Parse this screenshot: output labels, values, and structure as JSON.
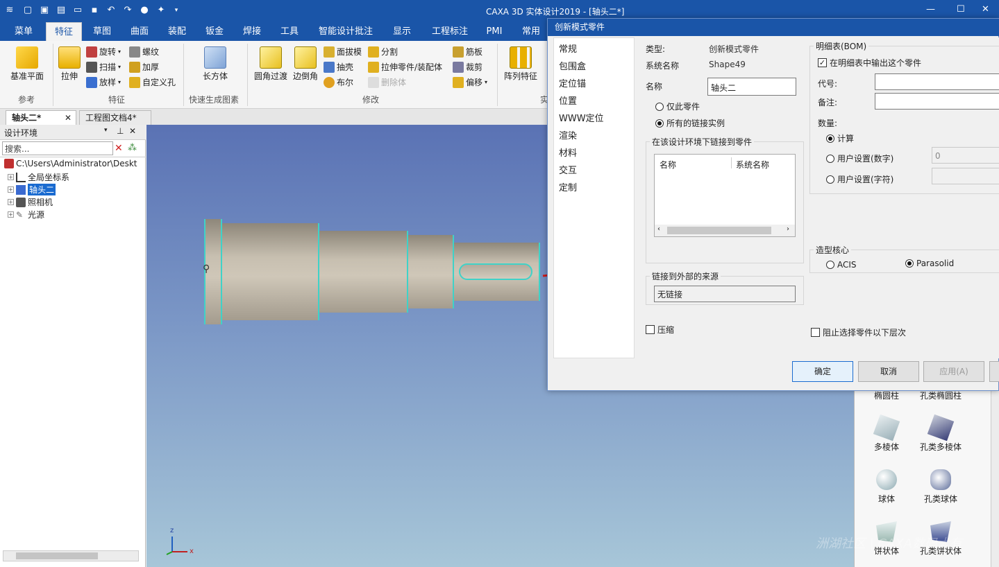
{
  "app": {
    "title": "CAXA 3D 实体设计2019 - [轴头二*]"
  },
  "menu_tabs": [
    "菜单",
    "特征",
    "草图",
    "曲面",
    "装配",
    "钣金",
    "焊接",
    "工具",
    "智能设计批注",
    "显示",
    "工程标注",
    "PMI",
    "常用"
  ],
  "ribbon": {
    "datum_plane": "基准平面",
    "group_reference": "参考",
    "extrude": "拉伸",
    "revolve": "旋转",
    "sweep": "扫描",
    "loft": "放样",
    "thread": "螺纹",
    "thicken": "加厚",
    "custom_hole": "自定义孔",
    "group_feature": "特征",
    "box": "长方体",
    "group_quick": "快速生成图素",
    "fillet": "圆角过渡",
    "chamfer": "边倒角",
    "draft": "面拔模",
    "shell": "抽壳",
    "boolean": "布尔",
    "split": "分割",
    "extrude_part": "拉伸零件/装配体",
    "delete_body": "删除体",
    "rib": "筋板",
    "trim": "裁剪",
    "offset": "偏移",
    "group_modify": "修改",
    "pattern": "阵列特征",
    "group_solid": "实"
  },
  "doc_tabs": [
    "轴头二*",
    "工程图文档4*"
  ],
  "left_panel": {
    "title": "设计环境",
    "search_placeholder": "搜索...",
    "root": "C:\\Users\\Administrator\\Deskt",
    "items": [
      "全局坐标系",
      "轴头二",
      "照相机",
      "光源"
    ]
  },
  "shape_library": {
    "items": [
      "椭圆柱",
      "孔类椭圆柱",
      "多棱体",
      "孔类多棱体",
      "球体",
      "孔类球体",
      "饼状体",
      "孔类饼状体"
    ]
  },
  "dialog": {
    "title": "创新模式零件",
    "nav": [
      "常规",
      "包围盒",
      "定位锚",
      "位置",
      "WWW定位",
      "渲染",
      "材料",
      "交互",
      "定制"
    ],
    "type_label": "类型:",
    "type_value": "创新模式零件",
    "sysname_label": "系统名称",
    "sysname_value": "Shape49",
    "name_label": "名称",
    "name_value": "轴头二",
    "radio_only_part": "仅此零件",
    "radio_all_links": "所有的链接实例",
    "linked_group": "在该设计环境下链接到零件",
    "col_name": "名称",
    "col_sysname": "系统名称",
    "external_group": "链接到外部的来源",
    "external_value": "无链接",
    "compress": "压缩",
    "bom_group": "明细表(BOM)",
    "bom_output": "在明细表中输出这个零件",
    "code_label": "代号:",
    "remark_label": "备注:",
    "qty_label": "数量:",
    "qty_calc": "计算",
    "qty_user_num": "用户设置(数字)",
    "qty_user_num_value": "0",
    "qty_user_str": "用户设置(字符)",
    "kernel_group": "造型核心",
    "kernel_acis": "ACIS",
    "kernel_parasolid": "Parasolid",
    "block_select": "阻止选择零件以下层次",
    "ok": "确定",
    "cancel": "取消",
    "apply": "应用(A)"
  },
  "watermark": "洲湖社区 | CAXA数码大有",
  "axis": {
    "x": "x",
    "z": "z"
  }
}
